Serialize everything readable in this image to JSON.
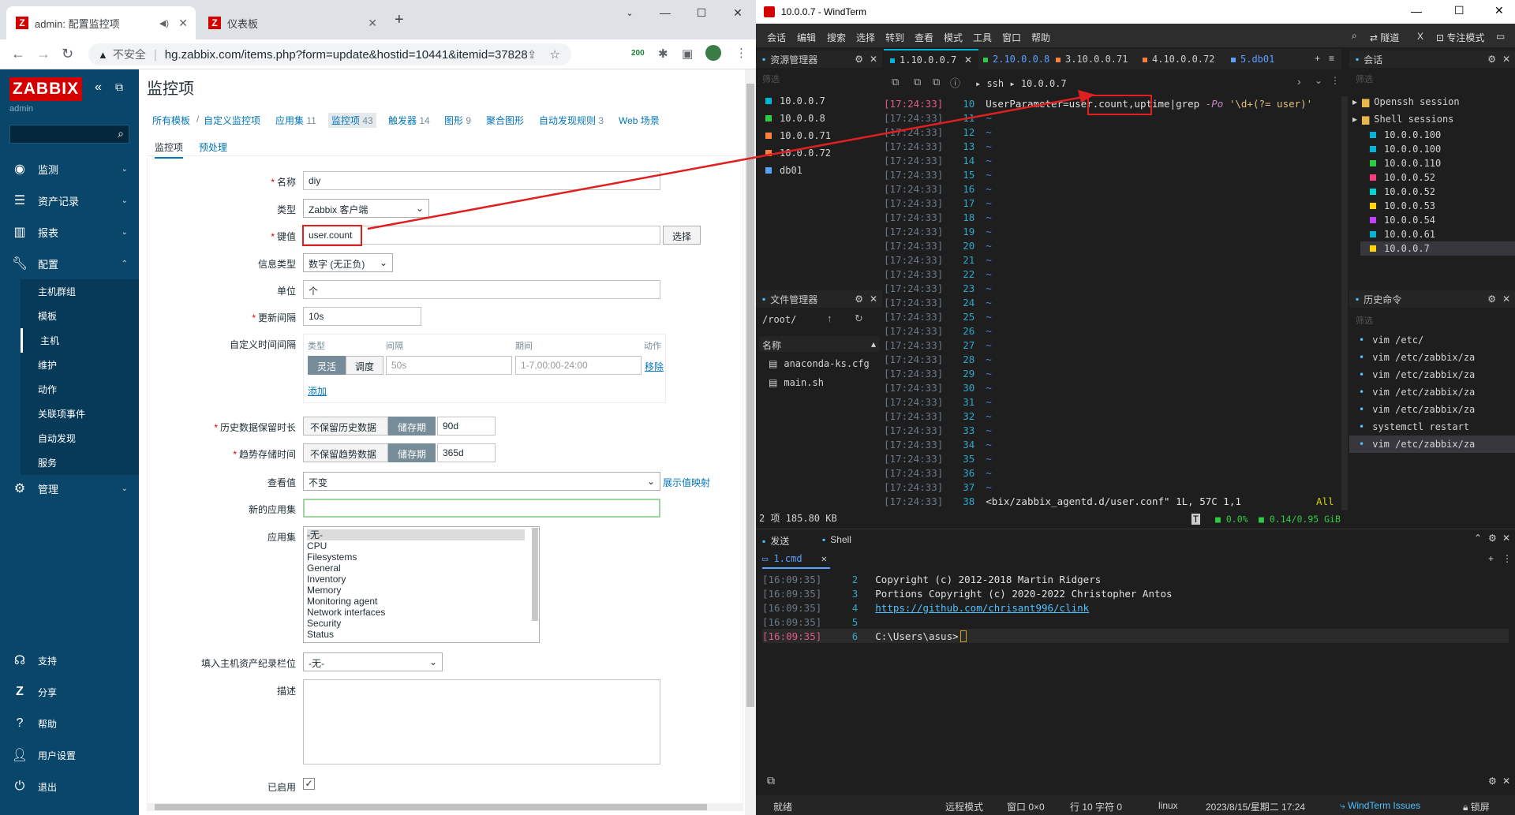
{
  "browser": {
    "tabs": [
      {
        "title": "admin: 配置监控项",
        "active": true
      },
      {
        "title": "仪表板",
        "active": false
      }
    ],
    "security_label": "不安全",
    "url": "hg.zabbix.com/items.php?form=update&hostid=10441&itemid=37828",
    "ext_badge": "200"
  },
  "zabbix": {
    "logo": "ZABBIX",
    "user": "admin",
    "menu": [
      {
        "label": "监测",
        "icon": "eye-icon"
      },
      {
        "label": "资产记录",
        "icon": "list-icon"
      },
      {
        "label": "报表",
        "icon": "chart-icon"
      },
      {
        "label": "配置",
        "icon": "wrench-icon"
      },
      {
        "label": "管理",
        "icon": "gear-icon"
      }
    ],
    "submenu": [
      "主机群组",
      "模板",
      "主机",
      "维护",
      "动作",
      "关联项事件",
      "自动发现",
      "服务"
    ],
    "footer": [
      "支持",
      "分享",
      "帮助",
      "用户设置",
      "退出"
    ],
    "footer_icons": [
      "support-icon",
      "share-icon",
      "help-icon",
      "user-icon",
      "logout-icon"
    ],
    "page_title": "监控项",
    "breadcrumbs": [
      {
        "label": "所有模板",
        "count": ""
      },
      {
        "label": "自定义监控项",
        "count": ""
      },
      {
        "label": "应用集",
        "count": "11"
      },
      {
        "label": "监控项",
        "count": "43"
      },
      {
        "label": "触发器",
        "count": "14"
      },
      {
        "label": "图形",
        "count": "9"
      },
      {
        "label": "聚合图形",
        "count": ""
      },
      {
        "label": "自动发现规则",
        "count": "3"
      },
      {
        "label": "Web 场景",
        "count": ""
      }
    ],
    "subtabs": [
      "监控项",
      "预处理"
    ],
    "form": {
      "name_label": "名称",
      "name_value": "diy",
      "type_label": "类型",
      "type_value": "Zabbix 客户端",
      "key_label": "键值",
      "key_value": "user.count",
      "select_btn": "选择",
      "info_type_label": "信息类型",
      "info_type_value": "数字 (无正负)",
      "units_label": "单位",
      "units_value": "个",
      "interval_label": "更新间隔",
      "interval_value": "10s",
      "custom_label": "自定义时间间隔",
      "custom_headers": [
        "类型",
        "间隔",
        "期间",
        "动作"
      ],
      "flexible": "灵活",
      "scheduling": "调度",
      "custom_interval_ph": "50s",
      "custom_period_ph": "1-7,00:00-24:00",
      "remove": "移除",
      "add": "添加",
      "history_label": "历史数据保留时长",
      "history_opt1": "不保留历史数据",
      "history_opt2": "储存期",
      "history_value": "90d",
      "trend_label": "趋势存储时间",
      "trend_opt1": "不保留趋势数据",
      "trend_opt2": "储存期",
      "trend_value": "365d",
      "valuemap_label": "查看值",
      "valuemap_value": "不变",
      "valuemap_link": "展示值映射",
      "newapp_label": "新的应用集",
      "newapp_value": "",
      "apps_label": "应用集",
      "apps": [
        "-无-",
        "CPU",
        "Filesystems",
        "General",
        "Inventory",
        "Memory",
        "Monitoring agent",
        "Network interfaces",
        "Security",
        "Status"
      ],
      "inventory_label": "填入主机资产纪录栏位",
      "inventory_value": "-无-",
      "desc_label": "描述",
      "desc_value": "",
      "enabled_label": "已启用"
    }
  },
  "windterm": {
    "title": "10.0.0.7 - WindTerm",
    "menu": [
      "会话",
      "编辑",
      "搜索",
      "选择",
      "转到",
      "查看",
      "模式",
      "工具",
      "窗口",
      "帮助"
    ],
    "toolbar_right": [
      "隧道",
      "专注模式"
    ],
    "explorer_title": "资源管理器",
    "filter": "筛选",
    "explorer_items": [
      {
        "name": "10.0.0.7",
        "color": "#00b4d8"
      },
      {
        "name": "10.0.0.8",
        "color": "#2ecc40"
      },
      {
        "name": "10.0.0.71",
        "color": "#ff7f3f"
      },
      {
        "name": "10.0.0.72",
        "color": "#ff7f3f"
      },
      {
        "name": "db01",
        "color": "#5aa0ff"
      }
    ],
    "term_tabs": [
      {
        "label": "1.10.0.0.7",
        "color": "#00b4d8"
      },
      {
        "label": "2.10.0.0.8",
        "color": "#2ecc40"
      },
      {
        "label": "3.10.0.0.71",
        "color": "#ff7f3f"
      },
      {
        "label": "4.10.0.0.72",
        "color": "#ff7f3f"
      },
      {
        "label": "5.db01",
        "color": "#5aa0ff"
      }
    ],
    "path": [
      "ssh",
      "10.0.0.7"
    ],
    "term_lines": {
      "timestamp": "[17:24:33]",
      "first_line": "10",
      "last_line": "38",
      "code_a": "UserParameter=",
      "code_key": "user.count",
      "code_b": ",uptime|grep ",
      "code_flag": "-Po",
      "code_c": " '\\d+(?= user)'",
      "statusline": "<bix/zabbix_agentd.d/user.conf\" 1L, 57C 1,1",
      "statusline_right": "All"
    },
    "file_manager_title": "文件管理器",
    "file_path": "/root/",
    "file_col": "名称",
    "files": [
      "anaconda-ks.cfg",
      "main.sh"
    ],
    "file_summary": "2 项 185.80 KB",
    "res": {
      "cpu": "0.0%",
      "mem": "0.14/0.95 GiB"
    },
    "session_title": "会话",
    "session_groups": [
      "Openssh session",
      "Shell sessions"
    ],
    "sessions": [
      {
        "name": "10.0.0.100",
        "color": "#00b4d8"
      },
      {
        "name": "10.0.0.100",
        "color": "#00b4d8"
      },
      {
        "name": "10.0.0.110",
        "color": "#2ecc40"
      },
      {
        "name": "10.0.0.52",
        "color": "#ff3f7f"
      },
      {
        "name": "10.0.0.52",
        "color": "#00d4d4"
      },
      {
        "name": "10.0.0.53",
        "color": "#ffd400"
      },
      {
        "name": "10.0.0.54",
        "color": "#c040ff"
      },
      {
        "name": "10.0.0.61",
        "color": "#00b4d8"
      },
      {
        "name": "10.0.0.7",
        "color": "#ffd400"
      }
    ],
    "history_title": "历史命令",
    "history": [
      "vim /etc/",
      "vim /etc/zabbix/za",
      "vim /etc/zabbix/za",
      "vim /etc/zabbix/za",
      "vim /etc/zabbix/za",
      "systemctl restart",
      "vim /etc/zabbix/za"
    ],
    "bottom_tabs": [
      "发送",
      "Shell"
    ],
    "shell_tab": "1.cmd",
    "shell_lines": [
      {
        "ts": "[16:09:35]",
        "n": "2",
        "text": "Copyright (c) 2012-2018 Martin Ridgers"
      },
      {
        "ts": "[16:09:35]",
        "n": "3",
        "text": "Portions Copyright (c) 2020-2022 Christopher Antos"
      },
      {
        "ts": "[16:09:35]",
        "n": "4",
        "text": "https://github.com/chrisant996/clink"
      },
      {
        "ts": "[16:09:35]",
        "n": "5",
        "text": ""
      },
      {
        "ts": "[16:09:35]",
        "n": "6",
        "text": "C:\\Users\\asus>"
      }
    ],
    "status": {
      "ready": "就绪",
      "mode": "远程模式",
      "window": "窗口 0×0",
      "pos": "行 10 字符 0",
      "os": "linux",
      "datetime": "2023/8/15/星期二 17:24",
      "issues": "WindTerm Issues",
      "lock": "锁屏"
    }
  }
}
